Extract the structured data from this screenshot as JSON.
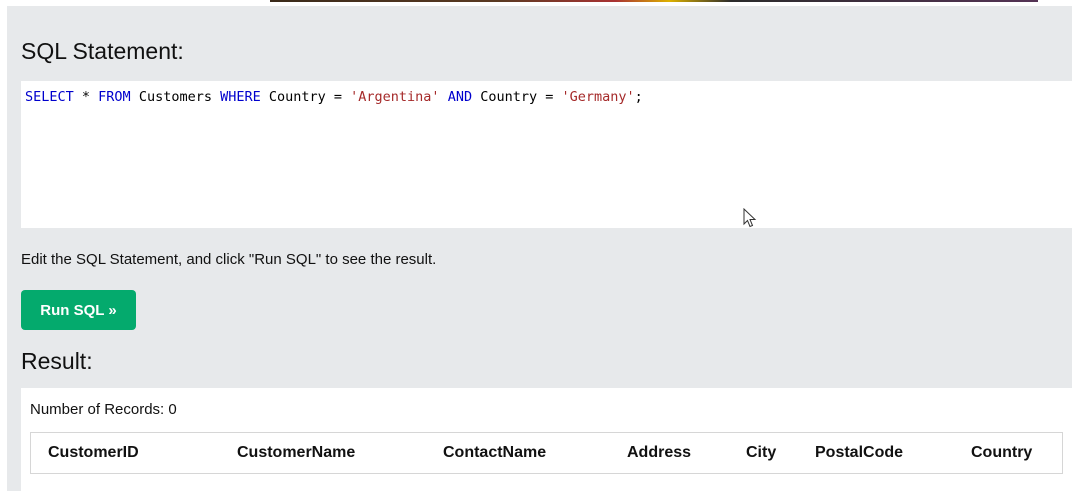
{
  "sql_section": {
    "heading": "SQL Statement:",
    "tokens": [
      {
        "text": "SELECT",
        "kind": "kw"
      },
      {
        "text": " * ",
        "kind": "plain"
      },
      {
        "text": "FROM",
        "kind": "kw"
      },
      {
        "text": " Customers ",
        "kind": "plain"
      },
      {
        "text": "WHERE",
        "kind": "kw"
      },
      {
        "text": " Country = ",
        "kind": "plain"
      },
      {
        "text": "'Argentina'",
        "kind": "str"
      },
      {
        "text": " ",
        "kind": "plain"
      },
      {
        "text": "AND",
        "kind": "kw"
      },
      {
        "text": " Country = ",
        "kind": "plain"
      },
      {
        "text": "'Germany'",
        "kind": "str"
      },
      {
        "text": ";",
        "kind": "plain"
      }
    ]
  },
  "hint": "Edit the SQL Statement, and click \"Run SQL\" to see the result.",
  "run_button": {
    "label": "Run SQL »"
  },
  "result": {
    "heading": "Result:",
    "record_count": "Number of Records: 0",
    "columns": [
      "CustomerID",
      "CustomerName",
      "ContactName",
      "Address",
      "City",
      "PostalCode",
      "Country"
    ]
  },
  "colors": {
    "panel_background": "#e7e9eb",
    "run_button": "#04aa6d",
    "sql_keyword": "#0000cd",
    "sql_string": "#a52a2a"
  },
  "icons": {
    "cursor": "mouse-pointer-icon"
  }
}
